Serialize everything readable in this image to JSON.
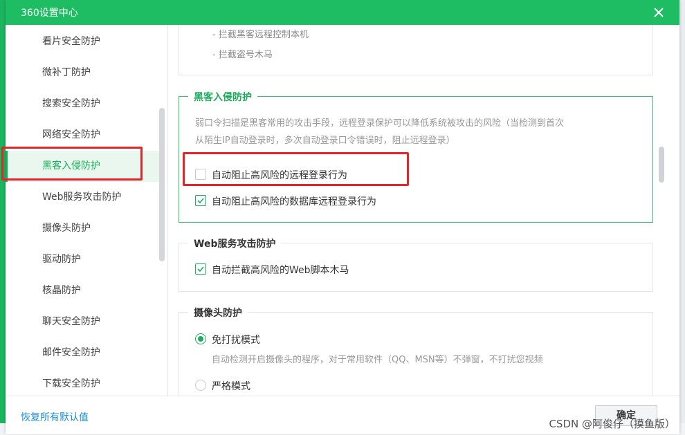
{
  "window": {
    "title": "360设置中心"
  },
  "sidebar": {
    "items": [
      {
        "label": "看片安全防护"
      },
      {
        "label": "微补丁防护"
      },
      {
        "label": "搜索安全防护"
      },
      {
        "label": "网络安全防护"
      },
      {
        "label": "黑客入侵防护",
        "active": true
      },
      {
        "label": "Web服务攻击防护"
      },
      {
        "label": "摄像头防护"
      },
      {
        "label": "驱动防护"
      },
      {
        "label": "核晶防护"
      },
      {
        "label": "聊天安全防护"
      },
      {
        "label": "邮件安全防护"
      },
      {
        "label": "下载安全防护"
      }
    ]
  },
  "prev_section": {
    "bullets": [
      "- 拦截黑客远程控制本机",
      "- 拦截盗号木马"
    ]
  },
  "hacker_section": {
    "title": "黑客入侵防护",
    "desc_line1": "弱口令扫描是黑客常用的攻击手段，远程登录保护可以降低系统被攻击的风险（当检测到首次",
    "desc_line2": "从陌生IP自动登录时，多次自动登录口令错误时，阻止远程登录）",
    "option1": {
      "label": "自动阻止高风险的远程登录行为",
      "checked": false
    },
    "option2": {
      "label": "自动阻止高风险的数据库远程登录行为",
      "checked": true
    }
  },
  "web_section": {
    "title": "Web服务攻击防护",
    "option1": {
      "label": "自动拦截高风险的Web脚本木马",
      "checked": true
    }
  },
  "camera_section": {
    "title": "摄像头防护",
    "mode1": {
      "label": "免打扰模式",
      "selected": true
    },
    "mode1_desc": "自动检测开启摄像头的程序，对于常用软件（QQ、MSN等）不弹窗，不打扰您视频",
    "mode2": {
      "label": "严格模式",
      "selected": false
    }
  },
  "footer": {
    "restore_label": "恢复所有默认值",
    "ok_label": "确定"
  },
  "watermark": "CSDN @阿俊仔（摸鱼版）",
  "colors": {
    "brand": "#1ebd63",
    "accent": "#1aad5c",
    "highlight": "#e5242a",
    "link": "#1a8cd8"
  }
}
